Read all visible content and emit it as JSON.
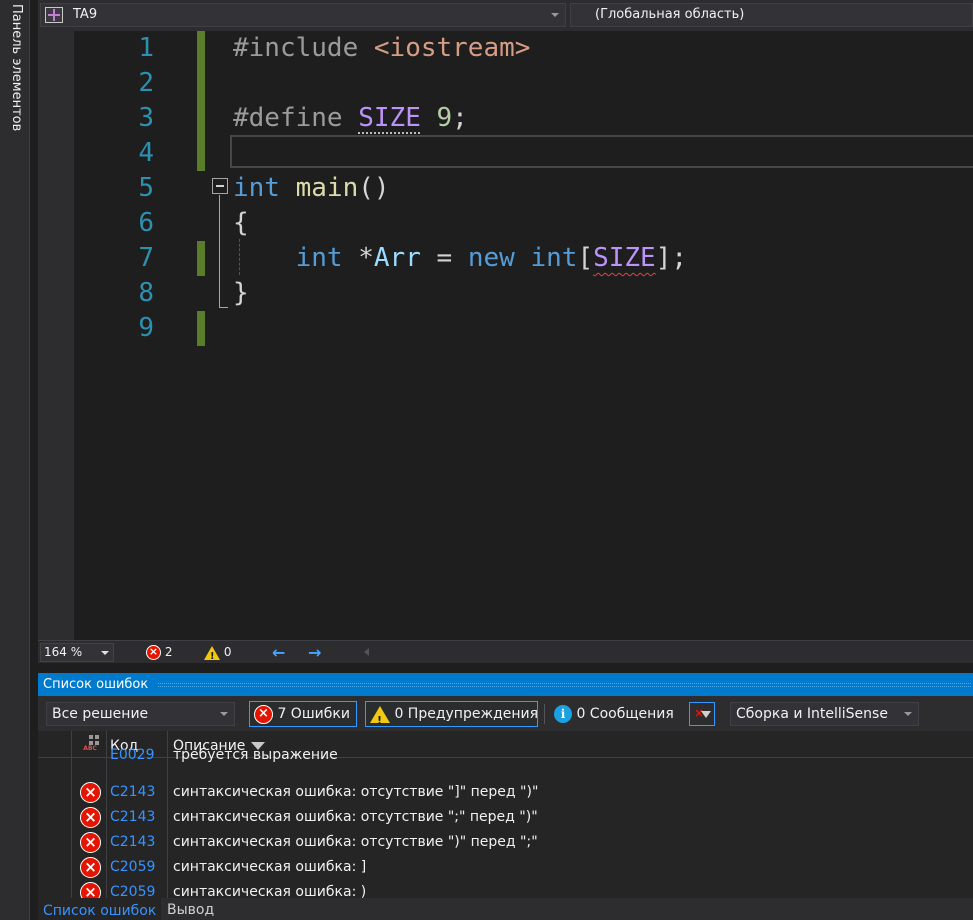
{
  "side_panel": {
    "label": "Панель элементов"
  },
  "navbar": {
    "project": "TA9",
    "scope": "(Глобальная область)",
    "project_icon": "project-icon"
  },
  "editor": {
    "line_numbers": [
      "1",
      "2",
      "3",
      "4",
      "5",
      "6",
      "7",
      "8",
      "9"
    ],
    "lines": [
      {
        "tokens": [
          {
            "t": "#include ",
            "c": "pp"
          },
          {
            "t": "<iostream>",
            "c": "str"
          }
        ]
      },
      {
        "tokens": []
      },
      {
        "tokens": [
          {
            "t": "#define ",
            "c": "pp"
          },
          {
            "t": "SIZE",
            "c": "macro dotted"
          },
          {
            "t": " ",
            "c": "punc"
          },
          {
            "t": "9",
            "c": "num"
          },
          {
            "t": ";",
            "c": "punc"
          }
        ]
      },
      {
        "tokens": []
      },
      {
        "tokens": [
          {
            "t": "int",
            "c": "kw"
          },
          {
            "t": " ",
            "c": "punc"
          },
          {
            "t": "main",
            "c": "fn"
          },
          {
            "t": "()",
            "c": "punc"
          }
        ]
      },
      {
        "tokens": [
          {
            "t": "{",
            "c": "punc"
          }
        ]
      },
      {
        "tokens": [
          {
            "t": "    ",
            "c": "punc"
          },
          {
            "t": "int",
            "c": "kw"
          },
          {
            "t": " *",
            "c": "punc"
          },
          {
            "t": "Arr",
            "c": "var"
          },
          {
            "t": " = ",
            "c": "punc"
          },
          {
            "t": "new",
            "c": "kw"
          },
          {
            "t": " ",
            "c": "punc"
          },
          {
            "t": "int",
            "c": "kw"
          },
          {
            "t": "[",
            "c": "punc"
          },
          {
            "t": "SIZE",
            "c": "macro squiggle"
          },
          {
            "t": "];",
            "c": "punc"
          }
        ]
      },
      {
        "tokens": [
          {
            "t": "}",
            "c": "punc"
          }
        ]
      },
      {
        "tokens": []
      }
    ],
    "changed_lines": [
      1,
      2,
      3,
      4,
      7,
      9
    ],
    "current_line": 4
  },
  "editor_status": {
    "zoom": "164 %",
    "errors": "2",
    "warnings": "0"
  },
  "error_list": {
    "title": "Список ошибок",
    "scope_filter": "Все решение",
    "errors_button": "7 Ошибки",
    "warnings_button": "0 Предупреждения",
    "messages_button": "0 Сообщения",
    "source_filter": "Сборка и IntelliSense",
    "columns": {
      "code": "Код",
      "description": "Описание"
    },
    "rows": [
      {
        "icon": "intellisense-error-icon",
        "code": "E0029",
        "description": "требуется выражение"
      },
      {
        "icon": "error-icon",
        "code": "C2143",
        "description": "синтаксическая ошибка: отсутствие \"]\" перед \")\""
      },
      {
        "icon": "error-icon",
        "code": "C2143",
        "description": "синтаксическая ошибка: отсутствие \";\" перед \")\""
      },
      {
        "icon": "error-icon",
        "code": "C2143",
        "description": "синтаксическая ошибка: отсутствие \")\" перед \";\""
      },
      {
        "icon": "error-icon",
        "code": "C2059",
        "description": "синтаксическая ошибка: ]"
      },
      {
        "icon": "error-icon",
        "code": "C2059",
        "description": "синтаксическая ошибка: )"
      }
    ]
  },
  "bottom_tabs": [
    "Список ошибок",
    "Вывод"
  ],
  "colors": {
    "accent": "#007acc",
    "error": "#e51400",
    "warning": "#f2c811",
    "info": "#1ba1e2",
    "change_bar": "#5a7d2a",
    "line_number": "#2b91af"
  }
}
